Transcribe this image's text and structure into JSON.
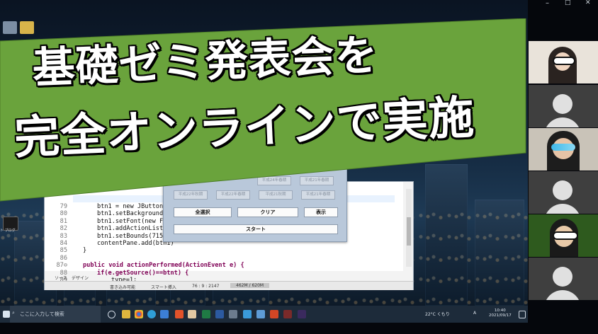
{
  "banner": {
    "line1": "基礎ゼミ発表会を",
    "line2": "完全オンラインで実施",
    "color": "#6aa33c"
  },
  "ide": {
    "lines": [
      {
        "num": "79",
        "text": "btn1 = new JButton(\"‥"
      },
      {
        "num": "80",
        "text": "btn1.setBackground(Sy"
      },
      {
        "num": "81",
        "text": "btn1.setFont(new Font"
      },
      {
        "num": "82",
        "text": "btn1.addActionListene"
      },
      {
        "num": "83",
        "text": "btn1.setBounds(715, 2"
      },
      {
        "num": "84",
        "text": "contentPane.add(btn1)"
      },
      {
        "num": "85",
        "text": "}"
      },
      {
        "num": "86",
        "text": ""
      },
      {
        "num": "87⊖",
        "text": "public void actionPerformed(ActionEvent e) {"
      },
      {
        "num": "88",
        "text": "if(e.getSource()==btnt) {"
      },
      {
        "num": "89",
        "text": "type=1;"
      }
    ],
    "tab_console": "ソース",
    "tab_design": "デザイン",
    "status_writable": "書き込み可能",
    "status_insert": "スマート挿入",
    "status_pos": "76 : 9 : 2147",
    "status_mem": "462M / 620M"
  },
  "app": {
    "era_row1": [
      "平成24年春期",
      "平成21年春期"
    ],
    "era_row2": [
      "平成22年秋期",
      "平成22年春期",
      "平成21秋期",
      "平成21年春期"
    ],
    "select_all": "全選択",
    "clear": "クリア",
    "show": "表示",
    "start": "スタート"
  },
  "taskbar": {
    "search_placeholder": "ここに入力して検索",
    "weather": "22°C くもり",
    "language": "A",
    "time": "10:40",
    "date": "2021/09/17"
  },
  "desktop": {
    "icon_label": "ト ブログ"
  },
  "window_controls": {
    "minimize": "–",
    "maximize": "□",
    "close": "✕"
  }
}
